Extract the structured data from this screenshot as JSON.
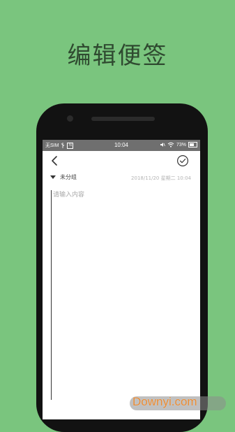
{
  "promo": {
    "title": "编辑便签"
  },
  "status_bar": {
    "carrier": "无SIM",
    "time": "10:04",
    "battery": "73%",
    "usb_label": "N",
    "icons": [
      "usb-icon",
      "notification-icon",
      "mute-icon",
      "wifi-icon",
      "battery-icon"
    ]
  },
  "toolbar": {
    "back_icon": "back-arrow-icon",
    "save_icon": "check-circle-icon"
  },
  "note": {
    "group_label": "未分组",
    "timestamp": "2018/11/20 星期二 10:04",
    "content_value": "",
    "content_placeholder": "请输入内容"
  },
  "watermark": {
    "text": "Downyi.com"
  },
  "colors": {
    "background": "#7ac57e",
    "status_bar": "#6f6f6f",
    "screen": "#ffffff",
    "phone_body": "#121212",
    "watermark": "#e98b34"
  }
}
